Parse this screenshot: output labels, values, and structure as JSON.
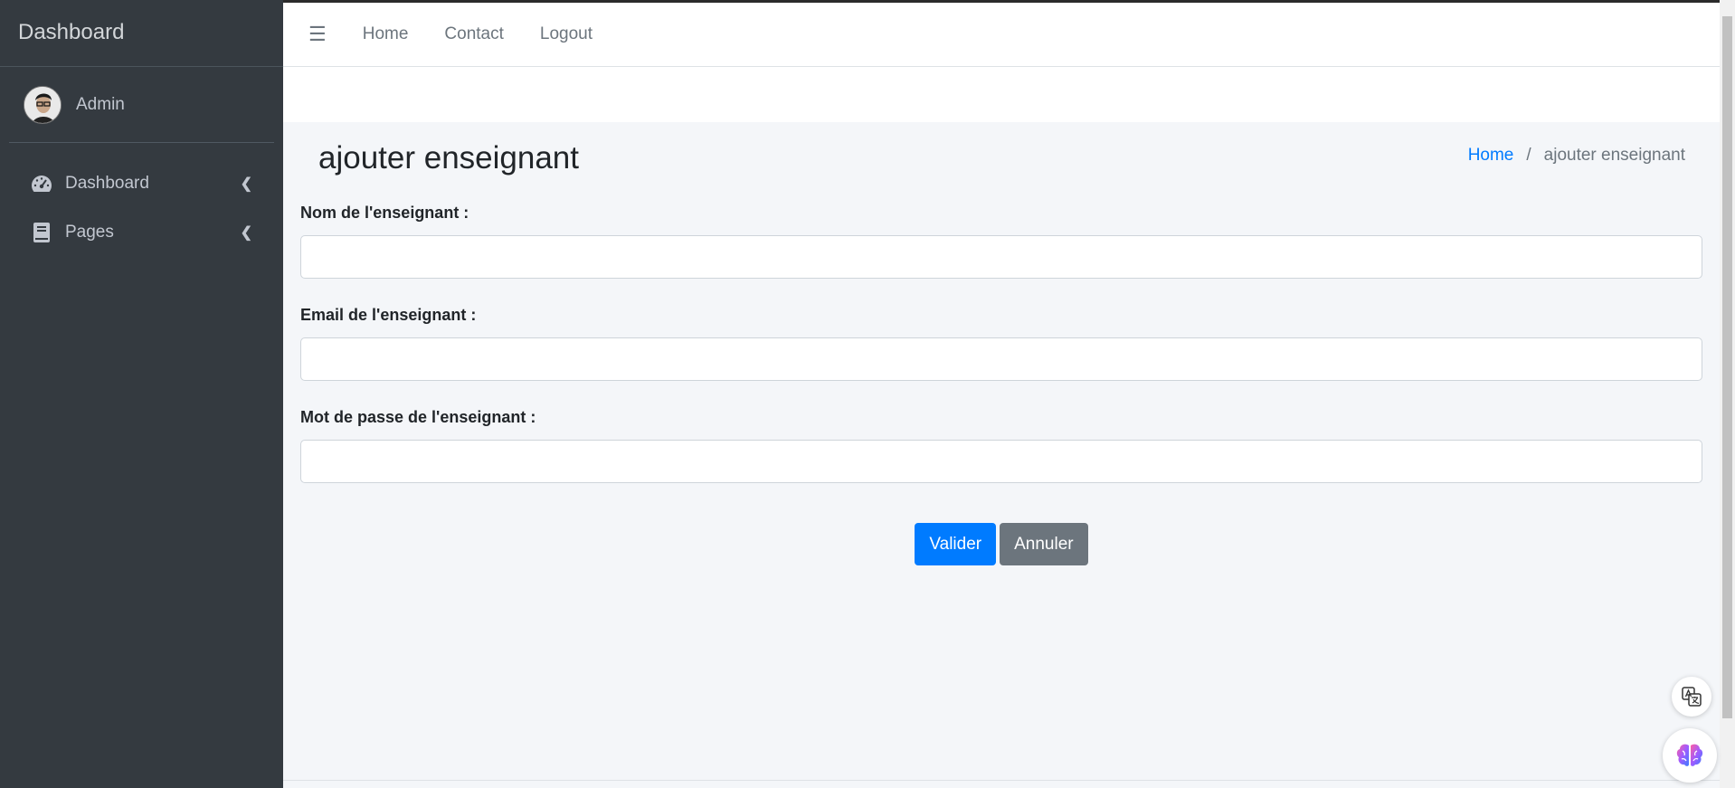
{
  "sidebar": {
    "brand": "Dashboard",
    "user_name": "Admin",
    "items": [
      {
        "label": "Dashboard",
        "icon": "tachometer-icon"
      },
      {
        "label": "Pages",
        "icon": "book-icon"
      }
    ]
  },
  "topbar": {
    "links": [
      "Home",
      "Contact",
      "Logout"
    ]
  },
  "page": {
    "title": "ajouter enseignant",
    "breadcrumb_home": "Home",
    "breadcrumb_separator": "/",
    "breadcrumb_current": "ajouter enseignant"
  },
  "form": {
    "name_label": "Nom de l'enseignant :",
    "name_value": "",
    "email_label": "Email de l'enseignant :",
    "email_value": "",
    "password_label": "Mot de passe de l'enseignant :",
    "password_value": "",
    "submit_label": "Valider",
    "cancel_label": "Annuler"
  },
  "colors": {
    "sidebar_bg": "#343a40",
    "primary": "#007bff",
    "secondary": "#6c757d",
    "content_bg": "#f4f6f9"
  }
}
